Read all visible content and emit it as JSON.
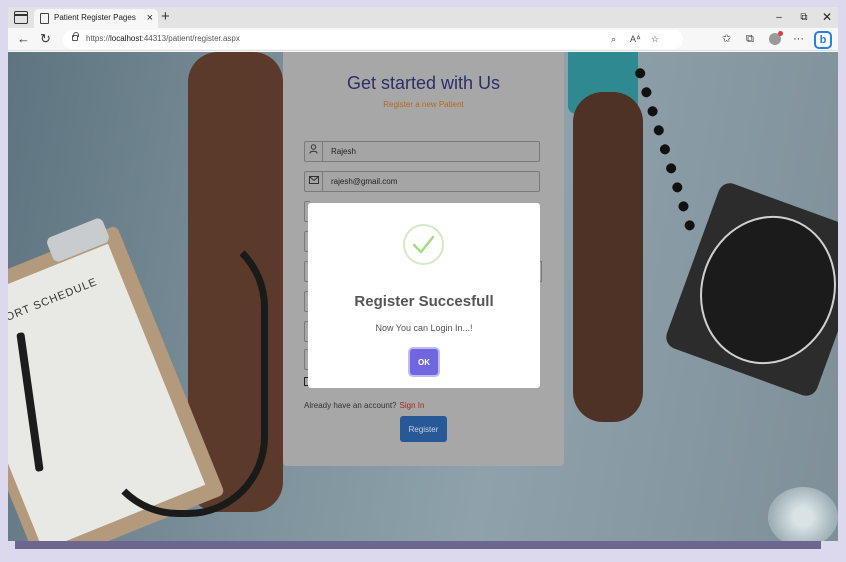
{
  "browser": {
    "tab_title": "Patient Register Pages",
    "tab_close": "×",
    "new_tab": "+",
    "window_minimize": "–",
    "window_restore": "⧉",
    "window_close": "✕",
    "url_prefix": "https://",
    "url_host": "localhost",
    "url_path": ":44313/patient/register.aspx",
    "icons": [
      "tab-actions-icon",
      "favicon-icon",
      "back-icon",
      "refresh-icon",
      "lock-icon",
      "search-in-page-icon",
      "read-aloud-icon",
      "favorite-add-icon",
      "favorites-icon",
      "collections-icon",
      "profile-icon",
      "more-icon",
      "bing-icon"
    ],
    "bing_glyph": "b",
    "more_glyph": "···"
  },
  "register_form": {
    "title": "Get started with Us",
    "subtitle": "Register a new Patient",
    "name_value": "Rajesh",
    "email_value": "rajesh@gmail.com",
    "account_prompt": "Already have an account?",
    "signin_link": "Sign In",
    "register_button": "Register",
    "subtitle_color": "#b56a1c",
    "title_color": "#2d2e6a"
  },
  "modal": {
    "title": "Register Succesfull",
    "message": "Now You can Login In...!",
    "ok_button": "OK",
    "ok_color": "#7066e0",
    "success_icon": "checkmark-icon"
  },
  "background": {
    "paper_text": "Y REPORT SCHEDULE"
  }
}
